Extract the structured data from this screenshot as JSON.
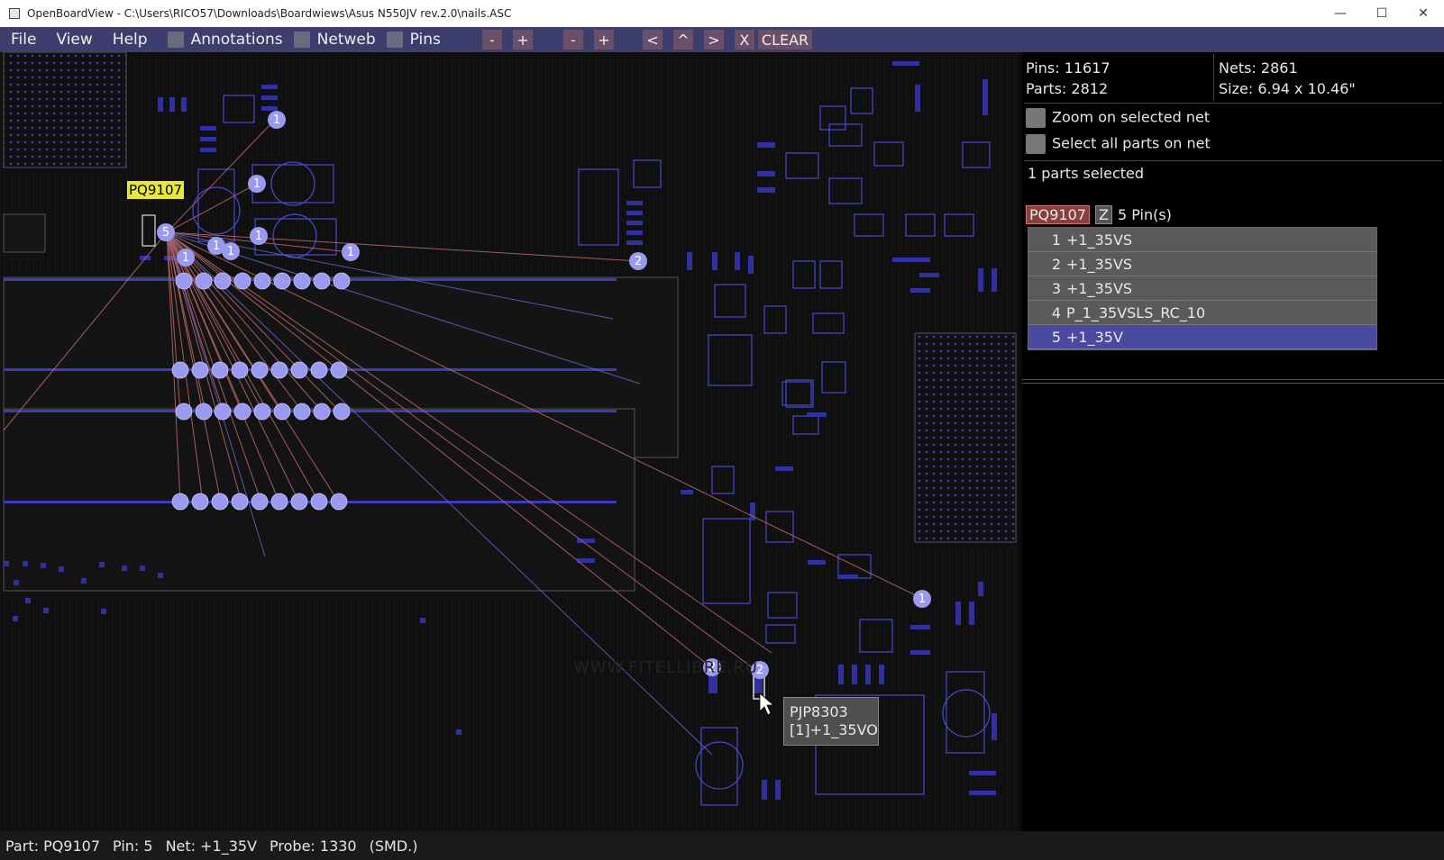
{
  "window": {
    "title": "OpenBoardView - C:\\Users\\RICO57\\Downloads\\Boardwiews\\Asus N550JV rev.2.0\\nails.ASC",
    "controls": [
      "—",
      "☐",
      "✕"
    ]
  },
  "menu": {
    "items": [
      "File",
      "View",
      "Help"
    ],
    "checkboxes": [
      "Annotations",
      "Netweb",
      "Pins"
    ],
    "buttons": [
      "-",
      "+",
      "-",
      "+",
      "<",
      "^",
      ">",
      "X",
      "CLEAR"
    ]
  },
  "board": {
    "part_label": "PQ9107",
    "watermark": "WWW.FITELLIBRE.RU",
    "tooltip_line1": "PJP8303",
    "tooltip_line2": "[1]+1_35VO",
    "pin_markers": [
      "1",
      "1",
      "5",
      "1",
      "1",
      "1",
      "1",
      "1",
      "2",
      "1",
      "2",
      "2"
    ]
  },
  "panel": {
    "pins": "Pins: 11617",
    "parts": "Parts: 2812",
    "nets": "Nets: 2861",
    "size": "Size: 6.94 x 10.46\"",
    "zoom_on_net": "Zoom on selected net",
    "select_all_on_net": "Select all parts on net",
    "selected_count": "1 parts selected",
    "part_name": "PQ9107",
    "part_flag": "Z",
    "pin_count": "5 Pin(s)",
    "pin_rows": [
      {
        "n": "1",
        "net": "+1_35VS"
      },
      {
        "n": "2",
        "net": "+1_35VS"
      },
      {
        "n": "3",
        "net": "+1_35VS"
      },
      {
        "n": "4",
        "net": "P_1_35VSLS_RC_10"
      },
      {
        "n": "5",
        "net": "+1_35V"
      }
    ],
    "selected_row": 4
  },
  "status": {
    "part": "Part: PQ9107",
    "pin": "Pin: 5",
    "net": "Net: +1_35V",
    "probe": "Probe: 1330",
    "type": "(SMD.)"
  },
  "colors": {
    "menubar": "#3d3d6e",
    "net_line": "#d07070",
    "pin_marker": "#9a9af0",
    "selected_row": "#4a4aa0"
  }
}
